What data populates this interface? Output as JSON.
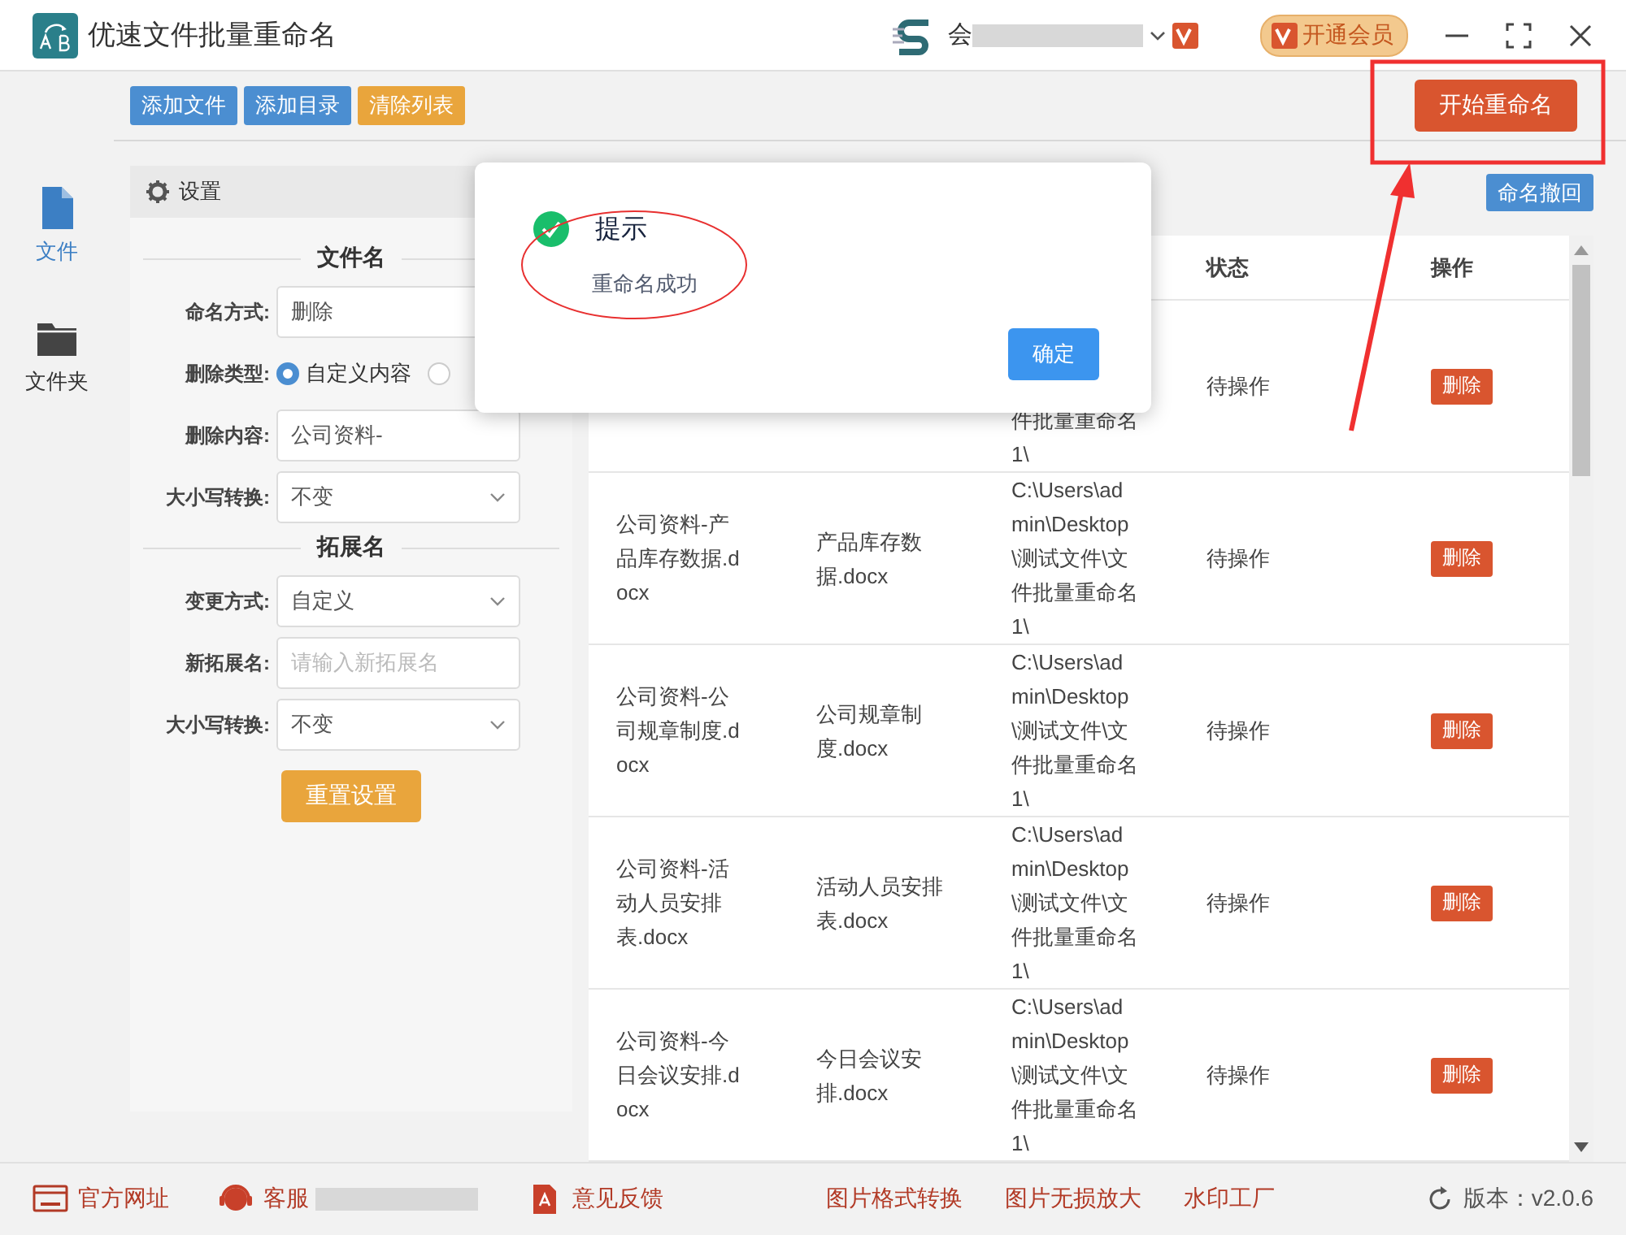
{
  "window": {
    "title": "优速文件批量重命名",
    "account": "会",
    "vip_button": "开通会员"
  },
  "nav": [
    {
      "label": "文件",
      "selected": true,
      "kind": "file"
    },
    {
      "label": "文件夹",
      "selected": false,
      "kind": "folder"
    }
  ],
  "toolbar": {
    "buttons": [
      {
        "label": "添加文件",
        "kind": "primary"
      },
      {
        "label": "添加目录",
        "kind": "primary"
      },
      {
        "label": "清除列表",
        "kind": "warning"
      }
    ],
    "start_button": "开始重命名"
  },
  "settings": {
    "title": "设置",
    "sections": [
      {
        "title": "文件名",
        "fields": [
          {
            "label": "命名方式:",
            "kind": "text",
            "value": "删除"
          },
          {
            "label": "删除类型:",
            "kind": "radio",
            "options": [
              {
                "label": "自定义内容",
                "selected": true
              },
              {
                "selected": false
              }
            ]
          },
          {
            "label": "删除内容:",
            "kind": "input",
            "value": "公司资料-"
          },
          {
            "label": "大小写转换:",
            "kind": "select",
            "value": "不变"
          }
        ]
      },
      {
        "title": "拓展名",
        "fields": [
          {
            "label": "变更方式:",
            "kind": "select",
            "value": "自定义"
          },
          {
            "label": "新拓展名:",
            "kind": "input",
            "placeholder": "请输入新拓展名"
          },
          {
            "label": "大小写转换:",
            "kind": "select",
            "value": "不变"
          }
        ]
      }
    ],
    "reset_button": "重置设置"
  },
  "table": {
    "undo_button": "命名撤回",
    "columns": [
      "状态",
      "操作"
    ],
    "rows": [
      {
        "path": [
          "件批量重命名",
          "1\\"
        ],
        "status": "待操作",
        "action": "删除"
      },
      {
        "original": [
          "公司资料-产",
          "品库存数据.d",
          "ocx"
        ],
        "new": [
          "产品库存数",
          "据.docx"
        ],
        "path": [
          "C:\\Users\\ad",
          "min\\Desktop",
          "\\测试文件\\文",
          "件批量重命名",
          "1\\"
        ],
        "status": "待操作",
        "action": "删除"
      },
      {
        "original": [
          "公司资料-公",
          "司规章制度.d",
          "ocx"
        ],
        "new": [
          "公司规章制",
          "度.docx"
        ],
        "path": [
          "C:\\Users\\ad",
          "min\\Desktop",
          "\\测试文件\\文",
          "件批量重命名",
          "1\\"
        ],
        "status": "待操作",
        "action": "删除"
      },
      {
        "original": [
          "公司资料-活",
          "动人员安排",
          "表.docx"
        ],
        "new": [
          "活动人员安排",
          "表.docx"
        ],
        "path": [
          "C:\\Users\\ad",
          "min\\Desktop",
          "\\测试文件\\文",
          "件批量重命名",
          "1\\"
        ],
        "status": "待操作",
        "action": "删除"
      },
      {
        "original": [
          "公司资料-今",
          "日会议安排.d",
          "ocx"
        ],
        "new": [
          "今日会议安",
          "排.docx"
        ],
        "path": [
          "C:\\Users\\ad",
          "min\\Desktop",
          "\\测试文件\\文",
          "件批量重命名",
          "1\\"
        ],
        "status": "待操作",
        "action": "删除"
      }
    ]
  },
  "dialog": {
    "kind": "success",
    "title": "提示",
    "message": "重命名成功",
    "ok_button": "确定"
  },
  "footer": {
    "links": [
      {
        "label": "官方网址",
        "kind": "web"
      },
      {
        "label": "客服",
        "kind": "support"
      },
      {
        "label": "意见反馈",
        "kind": "pdf"
      },
      {
        "label": "图片格式转换",
        "kind": "tool"
      },
      {
        "label": "图片无损放大",
        "kind": "tool"
      },
      {
        "label": "水印工厂",
        "kind": "tool"
      }
    ],
    "version": "版本：v2.0.6"
  }
}
